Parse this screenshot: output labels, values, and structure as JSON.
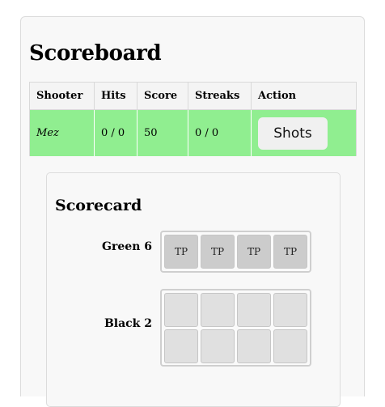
{
  "scoreboard": {
    "title": "Scoreboard",
    "headers": [
      "Shooter",
      "Hits",
      "Score",
      "Streaks",
      "Action"
    ],
    "row": {
      "shooter": "Mez",
      "hits": "0 / 0",
      "score": "50",
      "streaks": "0 / 0",
      "action_label": "Shots",
      "row_color": "#90ee90"
    }
  },
  "scorecard": {
    "title": "Scorecard",
    "stations": [
      {
        "label": "Green 6",
        "cells": [
          "TP",
          "TP",
          "TP",
          "TP"
        ]
      },
      {
        "label": "Black 2",
        "cells": [
          "",
          "",
          "",
          "",
          "",
          "",
          "",
          ""
        ]
      }
    ]
  }
}
